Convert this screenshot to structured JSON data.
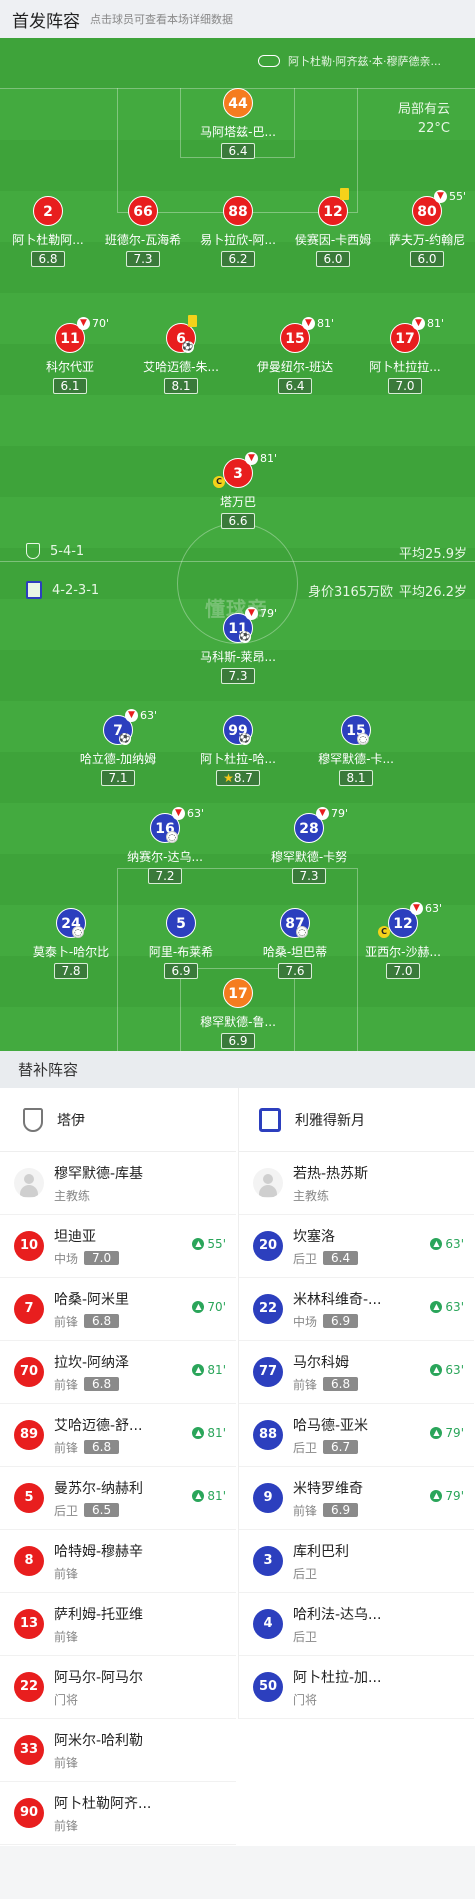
{
  "header": {
    "title": "首发阵容",
    "hint": "点击球员可查看本场详细数据"
  },
  "match": {
    "stadium": "阿卜杜勒·阿齐兹·本·穆萨德亲...",
    "weather": "局部有云",
    "temperature": "22°C",
    "watermark": "懂球帝"
  },
  "home": {
    "formation": "5-4-1",
    "avg_age": "平均25.9岁",
    "team": "塔伊",
    "players": [
      {
        "num": "44",
        "name": "马阿塔兹-巴...",
        "rating": "6.4"
      },
      {
        "num": "2",
        "name": "阿卜杜勒阿...",
        "rating": "6.8"
      },
      {
        "num": "66",
        "name": "班德尔-瓦海希",
        "rating": "7.3"
      },
      {
        "num": "88",
        "name": "易卜拉欣-阿...",
        "rating": "6.2"
      },
      {
        "num": "12",
        "name": "侯赛因-卡西姆",
        "rating": "6.0"
      },
      {
        "num": "80",
        "name": "萨夫万-约翰尼",
        "rating": "6.0",
        "sub": "55'"
      },
      {
        "num": "11",
        "name": "科尔代亚",
        "rating": "6.1",
        "sub": "70'"
      },
      {
        "num": "6",
        "name": "艾哈迈德-朱...",
        "rating": "8.1"
      },
      {
        "num": "15",
        "name": "伊曼纽尔-班达",
        "rating": "6.4",
        "sub": "81'"
      },
      {
        "num": "17",
        "name": "阿卜杜拉拉...",
        "rating": "7.0",
        "sub": "81'"
      },
      {
        "num": "3",
        "name": "塔万巴",
        "rating": "6.6",
        "sub": "81'"
      }
    ]
  },
  "away": {
    "formation": "4-2-3-1",
    "value": "身价3165万欧",
    "avg_age": "平均26.2岁",
    "team": "利雅得新月",
    "players": [
      {
        "num": "11",
        "name": "马科斯-莱昂...",
        "rating": "7.3",
        "sub": "79'"
      },
      {
        "num": "7",
        "name": "哈立德-加纳姆",
        "rating": "7.1",
        "sub": "63'"
      },
      {
        "num": "99",
        "name": "阿卜杜拉-哈...",
        "rating": "8.7"
      },
      {
        "num": "15",
        "name": "穆罕默德-卡...",
        "rating": "8.1"
      },
      {
        "num": "16",
        "name": "纳赛尔-达乌...",
        "rating": "7.2",
        "sub": "63'"
      },
      {
        "num": "28",
        "name": "穆罕默德-卡努",
        "rating": "7.3",
        "sub": "79'"
      },
      {
        "num": "24",
        "name": "莫泰卜-哈尔比",
        "rating": "7.8"
      },
      {
        "num": "5",
        "name": "阿里-布莱希",
        "rating": "6.9"
      },
      {
        "num": "87",
        "name": "哈桑-坦巴蒂",
        "rating": "7.6"
      },
      {
        "num": "12",
        "name": "亚西尔-沙赫...",
        "rating": "7.0",
        "sub": "63'"
      },
      {
        "num": "17",
        "name": "穆罕默德-鲁...",
        "rating": "6.9"
      }
    ]
  },
  "bench": {
    "title": "替补阵容",
    "left_team": "塔伊",
    "right_team": "利雅得新月",
    "left": [
      {
        "num": "",
        "name": "穆罕默德-库基",
        "pos": "主教练",
        "coach": true
      },
      {
        "num": "10",
        "name": "坦迪亚",
        "pos": "中场",
        "rating": "7.0",
        "time": "55'"
      },
      {
        "num": "7",
        "name": "哈桑-阿米里",
        "pos": "前锋",
        "rating": "6.8",
        "time": "70'"
      },
      {
        "num": "70",
        "name": "拉坎-阿纳泽",
        "pos": "前锋",
        "rating": "6.8",
        "time": "81'"
      },
      {
        "num": "89",
        "name": "艾哈迈德-舒...",
        "pos": "前锋",
        "rating": "6.8",
        "time": "81'"
      },
      {
        "num": "5",
        "name": "曼苏尔-纳赫利",
        "pos": "后卫",
        "rating": "6.5",
        "time": "81'"
      },
      {
        "num": "8",
        "name": "哈特姆-穆赫辛",
        "pos": "前锋"
      },
      {
        "num": "13",
        "name": "萨利姆-托亚维",
        "pos": "前锋"
      },
      {
        "num": "22",
        "name": "阿马尔-阿马尔",
        "pos": "门将"
      },
      {
        "num": "33",
        "name": "阿米尔-哈利勒",
        "pos": "前锋"
      },
      {
        "num": "90",
        "name": "阿卜杜勒阿齐...",
        "pos": "前锋"
      }
    ],
    "right": [
      {
        "num": "",
        "name": "若热-热苏斯",
        "pos": "主教练",
        "coach": true
      },
      {
        "num": "20",
        "name": "坎塞洛",
        "pos": "后卫",
        "rating": "6.4",
        "time": "63'"
      },
      {
        "num": "22",
        "name": "米林科维奇-...",
        "pos": "中场",
        "rating": "6.9",
        "time": "63'"
      },
      {
        "num": "77",
        "name": "马尔科姆",
        "pos": "前锋",
        "rating": "6.8",
        "time": "63'"
      },
      {
        "num": "88",
        "name": "哈马德-亚米",
        "pos": "后卫",
        "rating": "6.7",
        "time": "79'"
      },
      {
        "num": "9",
        "name": "米特罗维奇",
        "pos": "前锋",
        "rating": "6.9",
        "time": "79'"
      },
      {
        "num": "3",
        "name": "库利巴利",
        "pos": "后卫"
      },
      {
        "num": "4",
        "name": "哈利法-达乌...",
        "pos": "后卫"
      },
      {
        "num": "50",
        "name": "阿卜杜拉-加...",
        "pos": "门将"
      }
    ]
  },
  "colors": {
    "home": "#e81e1e",
    "away": "#2c3fbe",
    "gk": "#f57c1f",
    "pitch": "#43aa3f"
  }
}
